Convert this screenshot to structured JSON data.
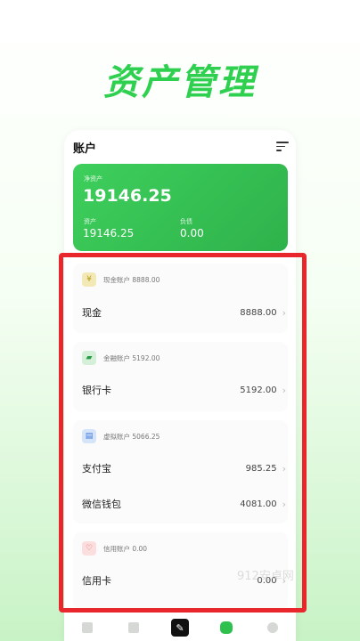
{
  "headline": "资产管理",
  "topbar": {
    "title": "账户"
  },
  "summary": {
    "total_label": "净资产",
    "total_value": "19146.25",
    "assets_label": "资产",
    "assets_value": "19146.25",
    "debt_label": "负债",
    "debt_value": "0.00"
  },
  "groups": [
    {
      "title": "现金账户 8888.00",
      "icon": "¥",
      "icon_color": "#f2e9b6",
      "rows": [
        {
          "name": "现金",
          "amount": "8888.00"
        }
      ]
    },
    {
      "title": "金融账户 5192.00",
      "icon": "▰",
      "icon_color": "#d4f0d9",
      "rows": [
        {
          "name": "银行卡",
          "amount": "5192.00"
        }
      ]
    },
    {
      "title": "虚拟账户 5066.25",
      "icon": "▤",
      "icon_color": "#d6e4fa",
      "rows": [
        {
          "name": "支付宝",
          "amount": "985.25"
        },
        {
          "name": "微信钱包",
          "amount": "4081.00"
        }
      ]
    },
    {
      "title": "信用账户 0.00",
      "icon": "♡",
      "icon_color": "#fbdede",
      "rows": [
        {
          "name": "信用卡",
          "amount": "0.00"
        }
      ]
    }
  ],
  "watermark": "912安卓网",
  "colors": {
    "accent": "#2fc04e",
    "highlight": "#e8262b"
  }
}
